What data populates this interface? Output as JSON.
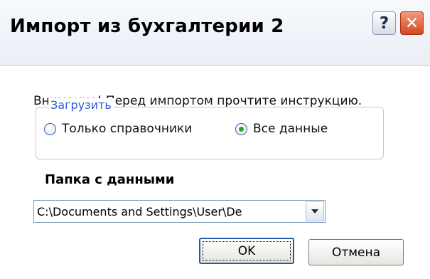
{
  "window": {
    "title": "Импорт из бухгалтерии 2",
    "help_label": "?",
    "close_label": "✕"
  },
  "body": {
    "warning": "Внимание! Перед импортом прочтите инструкцию.",
    "group_label": "Загрузить",
    "radio_options": [
      {
        "label": "Только справочники",
        "checked": false
      },
      {
        "label": "Все данные",
        "checked": true
      }
    ],
    "folder_label": "Папка с данными",
    "folder_value": "C:\\Documents and Settings\\User\\De",
    "ok_label": "OK",
    "cancel_label": "Отмена"
  },
  "colors": {
    "accent": "#2b5bd7",
    "close": "#d4461e",
    "radio_dot": "#2aa62a"
  },
  "icons": {
    "help": "help-icon",
    "close": "close-icon",
    "dropdown": "chevron-down-icon"
  }
}
